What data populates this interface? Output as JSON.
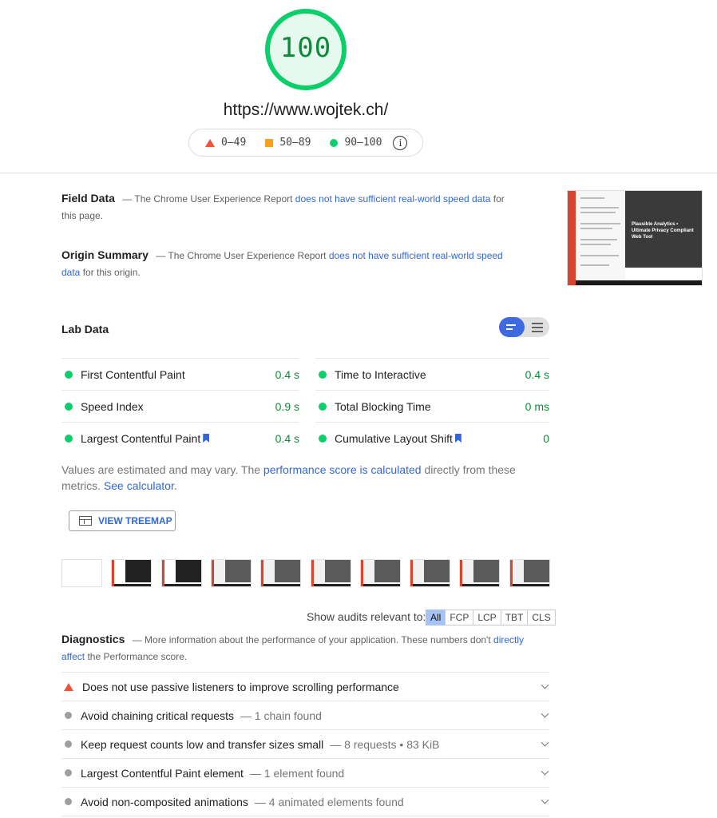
{
  "score": {
    "value": "100",
    "fraction": 1.0,
    "color": "#0cce6b"
  },
  "url": "https://www.wojtek.ch/",
  "legend": [
    {
      "icon": "fail-triangle-icon",
      "label": "0–49"
    },
    {
      "icon": "average-square-icon",
      "label": "50–89"
    },
    {
      "icon": "pass-circle-icon",
      "label": "90–100"
    }
  ],
  "field_data": {
    "title": "Field Data",
    "text_before": "— The Chrome User Experience Report ",
    "link": "does not have sufficient real-world speed data",
    "text_after": " for this page."
  },
  "origin_summary": {
    "title": "Origin Summary",
    "text_before": "— The Chrome User Experience Report ",
    "link": "does not have sufficient real-world speed data",
    "text_after": " for this origin."
  },
  "thumbnail": {
    "headline": "Plausible Analytics • Ultimate Privacy Compliant Web Tool"
  },
  "lab_data": {
    "title": "Lab Data",
    "metrics_left": [
      {
        "label": "First Contentful Paint",
        "value": "0.4 s",
        "bookmark": false
      },
      {
        "label": "Speed Index",
        "value": "0.9 s",
        "bookmark": false
      },
      {
        "label": "Largest Contentful Paint",
        "value": "0.4 s",
        "bookmark": true
      }
    ],
    "metrics_right": [
      {
        "label": "Time to Interactive",
        "value": "0.4 s",
        "bookmark": false
      },
      {
        "label": "Total Blocking Time",
        "value": "0 ms",
        "bookmark": false
      },
      {
        "label": "Cumulative Layout Shift",
        "value": "0",
        "bookmark": true
      }
    ],
    "note_before": "Values are estimated and may vary. The ",
    "note_link1": "performance score is calculated",
    "note_middle": " directly from these metrics. ",
    "note_link2": "See calculator."
  },
  "treemap_button": "VIEW TREEMAP",
  "filter": {
    "label": "Show audits relevant to:",
    "buttons": [
      "All",
      "FCP",
      "LCP",
      "TBT",
      "CLS"
    ],
    "selected": "All"
  },
  "diagnostics": {
    "title": "Diagnostics",
    "text_before": "— More information about the performance of your application. These numbers don't ",
    "link": "directly affect",
    "text_after": " the Performance score."
  },
  "audits": [
    {
      "status": "fail",
      "title": "Does not use passive listeners to improve scrolling performance",
      "detail": ""
    },
    {
      "status": "info",
      "title": "Avoid chaining critical requests",
      "detail": "— 1 chain found"
    },
    {
      "status": "info",
      "title": "Keep request counts low and transfer sizes small",
      "detail": "— 8 requests • 83 KiB"
    },
    {
      "status": "info",
      "title": "Largest Contentful Paint element",
      "detail": "— 1 element found"
    },
    {
      "status": "info",
      "title": "Avoid non-composited animations",
      "detail": "— 4 animated elements found"
    }
  ]
}
